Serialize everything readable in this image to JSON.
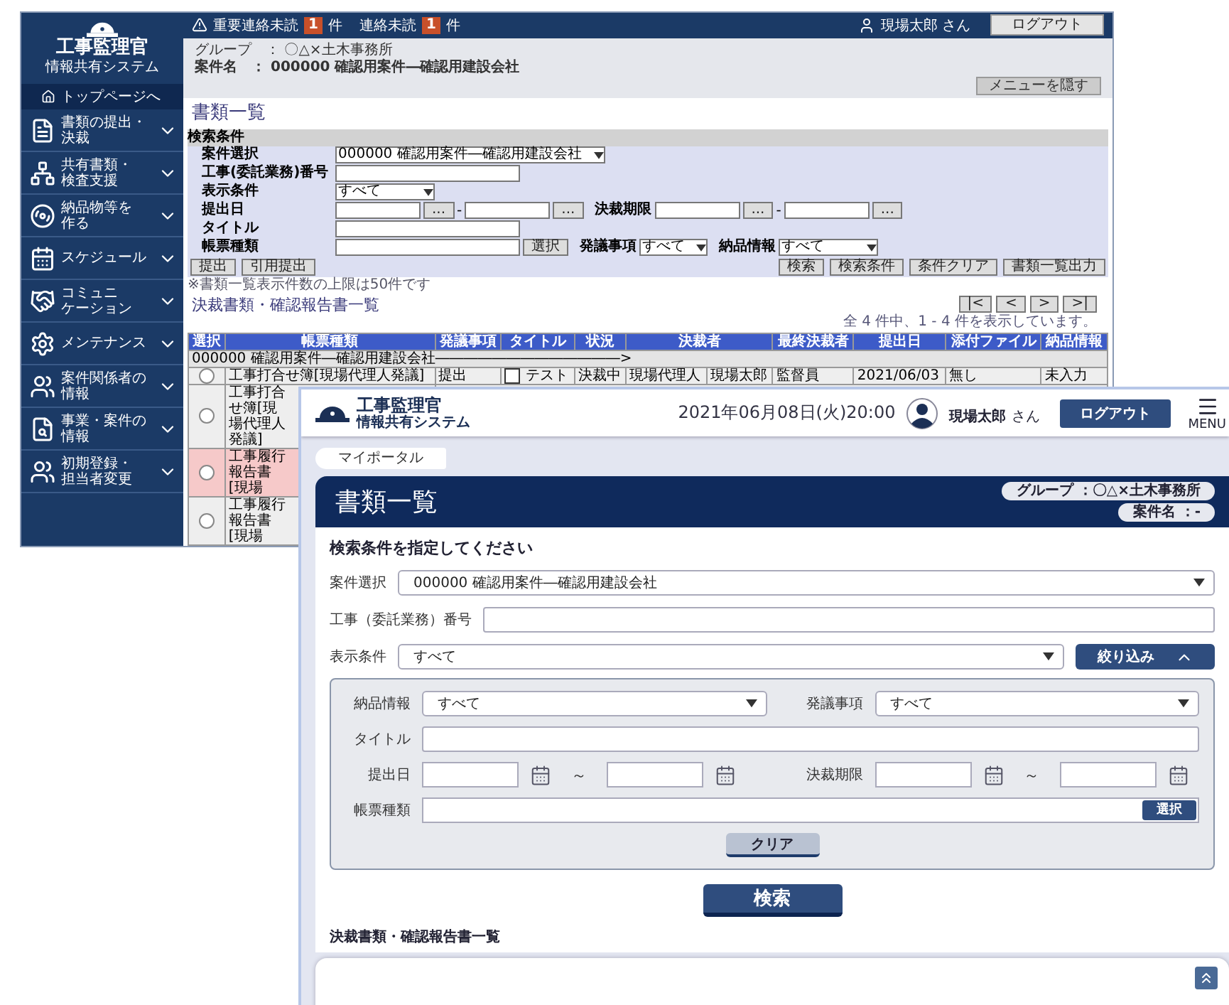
{
  "legacy_screen": {
    "brand": {
      "title": "工事監理官",
      "subtitle": "情報共有システム"
    },
    "top_link": "トップページへ",
    "sidebar_items": [
      {
        "lines": [
          "書類の提出・",
          "決裁"
        ]
      },
      {
        "lines": [
          "共有書類・",
          "検査支援"
        ]
      },
      {
        "lines": [
          "納品物等を",
          "作る"
        ]
      },
      {
        "lines": [
          "スケジュール"
        ]
      },
      {
        "lines": [
          "コミュニ",
          "ケーション"
        ]
      },
      {
        "lines": [
          "メンテナンス"
        ]
      },
      {
        "lines": [
          "案件関係者の",
          "情報"
        ]
      },
      {
        "lines": [
          "事業・案件の",
          "情報"
        ]
      },
      {
        "lines": [
          "初期登録・",
          "担当者変更"
        ]
      }
    ],
    "alerts": [
      {
        "label": "重要連絡未読",
        "count": "1",
        "unit": "件"
      },
      {
        "label": "連絡未読",
        "count": "1",
        "unit": "件"
      }
    ],
    "user": "現場太郎 さん",
    "logout": "ログアウト",
    "info": [
      {
        "label": "グループ　：",
        "value": "〇△×土木事務所",
        "bold": false
      },
      {
        "label": "案件名　：",
        "value": "000000 確認用案件―確認用建設会社",
        "bold": true
      }
    ],
    "hide_menu": "メニューを隠す",
    "page_title": "書類一覧",
    "search": {
      "heading": "検索条件",
      "project": {
        "label": "案件選択",
        "value": "000000 確認用案件―確認用建設会社"
      },
      "work_no": {
        "label": "工事(委託業務)番号"
      },
      "display": {
        "label": "表示条件",
        "value": "すべて"
      },
      "submitted": {
        "label": "提出日",
        "from_picker": "...",
        "dash": "-",
        "to_picker": "..."
      },
      "deadline": {
        "label": "決裁期限",
        "from_picker": "...",
        "dash": "-",
        "to_picker": "..."
      },
      "title": {
        "label": "タイトル"
      },
      "form_type": {
        "label": "帳票種類",
        "button": "選択"
      },
      "proposal": {
        "label": "発議事項",
        "value": "すべて"
      },
      "delivery": {
        "label": "納品情報",
        "value": "すべて"
      },
      "left_buttons": [
        "提出",
        "引用提出"
      ],
      "right_buttons": [
        "検索",
        "検索条件",
        "条件クリア",
        "書類一覧出力"
      ]
    },
    "note": "※書類一覧表示件数の上限は50件です",
    "list_title": "決裁書類・確認報告書一覧",
    "pager": [
      "|<",
      "<",
      ">",
      ">|"
    ],
    "count": "全 4 件中、1 - 4 件を表示しています。",
    "table": {
      "columns": [
        "選択",
        "帳票種類",
        "発議事項",
        "タイトル",
        "状況",
        "決裁者",
        "最終決裁者",
        "提出日",
        "添付ファイル",
        "納品情報"
      ],
      "group_row": "000000 確認用案件―確認用建設会社―――――――――――――>",
      "rows": [
        {
          "selected": false,
          "highlighted": false,
          "type": "工事打合せ簿[現場代理人発議]",
          "proposal": "提出",
          "title_checked": false,
          "title": "テスト",
          "status": "決裁中",
          "approver_role": "現場代理人",
          "approver_name": "現場太郎",
          "final_approver": "監督員",
          "submitted": "2021/06/03",
          "attachment": "無し",
          "delivery": "未入力"
        },
        {
          "selected": false,
          "highlighted": false,
          "type": "工事打合せ簿[現場代理人発議]"
        },
        {
          "selected": false,
          "highlighted": true,
          "type": "工事履行報告書[現場"
        },
        {
          "selected": false,
          "highlighted": false,
          "type": "工事履行報告書[現場"
        }
      ]
    }
  },
  "portal_screen": {
    "brand": {
      "title": "工事監理官",
      "subtitle": "情報共有システム"
    },
    "datetime": "2021年06月08日(火)20:00",
    "user": "現場太郎",
    "honorific": "さん",
    "logout": "ログアウト",
    "menu": "MENU",
    "breadcrumb": "マイポータル",
    "page_title": "書類一覧",
    "context": [
      "グループ ：〇△×土木事務所",
      "案件名 ：-"
    ],
    "search": {
      "prompt": "検索条件を指定してください",
      "project": {
        "label": "案件選択",
        "value": "000000 確認用案件―確認用建設会社"
      },
      "work_no": {
        "label": "工事（委託業務）番号"
      },
      "display": {
        "label": "表示条件",
        "value": "すべて"
      },
      "filter_button": {
        "label": "絞り込み",
        "expanded": true
      },
      "filters": {
        "delivery": {
          "label": "納品情報",
          "value": "すべて"
        },
        "proposal": {
          "label": "発議事項",
          "value": "すべて"
        },
        "title": {
          "label": "タイトル"
        },
        "submitted": {
          "label": "提出日",
          "separator": "～"
        },
        "deadline": {
          "label": "決裁期限",
          "separator": "～"
        },
        "form_type": {
          "label": "帳票種類",
          "button": "選択"
        },
        "clear": "クリア"
      },
      "search_button": "検索"
    },
    "list_title": "決裁書類・確認報告書一覧"
  }
}
